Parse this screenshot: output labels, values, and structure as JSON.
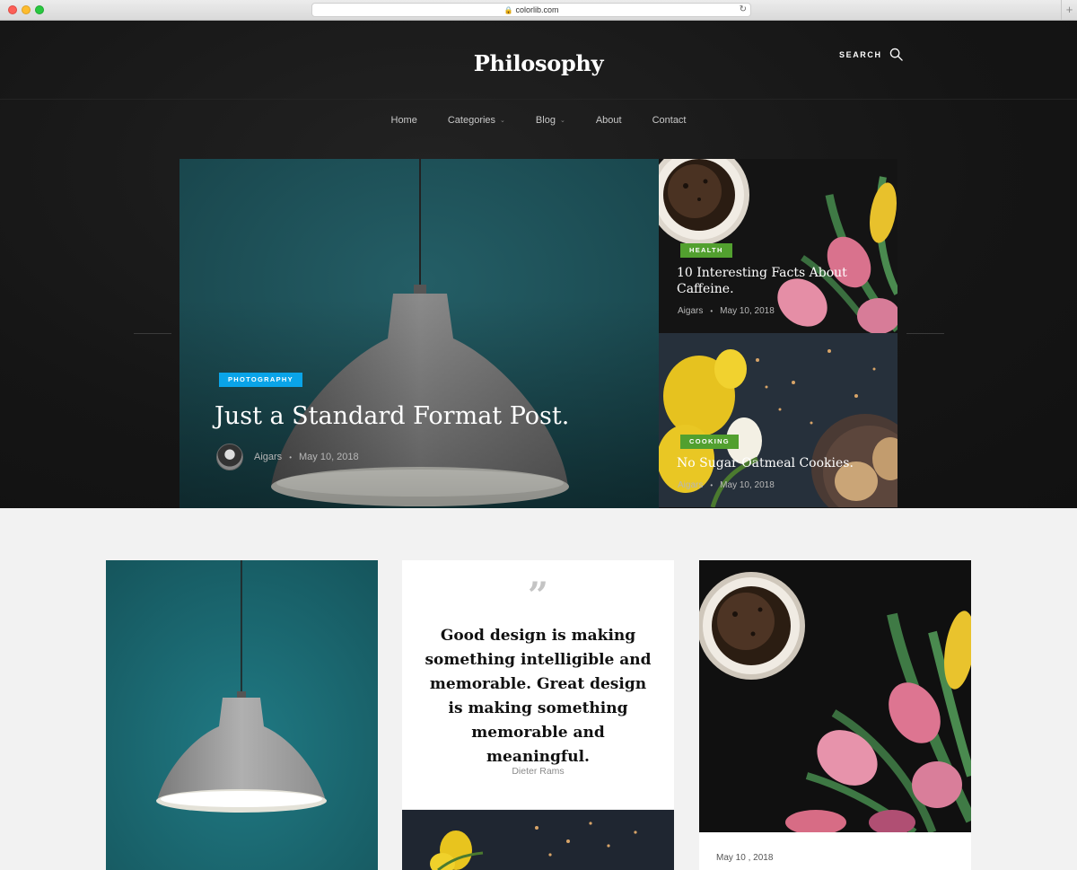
{
  "browser": {
    "url": "colorlib.com"
  },
  "site": {
    "title": "Philosophy",
    "search_label": "SEARCH"
  },
  "nav": [
    {
      "label": "Home"
    },
    {
      "label": "Categories",
      "dropdown": true
    },
    {
      "label": "Blog",
      "dropdown": true
    },
    {
      "label": "About"
    },
    {
      "label": "Contact"
    }
  ],
  "featured": {
    "main": {
      "category": "PHOTOGRAPHY",
      "category_color": "#0aa4e8",
      "title": "Just a Standard Format Post.",
      "author": "Aigars",
      "date": "May 10, 2018"
    },
    "side": [
      {
        "category": "HEALTH",
        "category_color": "#52a02f",
        "title": "10 Interesting Facts About Caffeine.",
        "author": "Aigars",
        "date": "May 10, 2018"
      },
      {
        "category": "COOKING",
        "category_color": "#52a02f",
        "title": "No Sugar Oatmeal Cookies.",
        "author": "Aigars",
        "date": "May 10, 2018"
      }
    ]
  },
  "cards": {
    "quote": {
      "mark": "”",
      "text": "Good design is making something intelligible and memorable. Great design is making something memorable and meaningful.",
      "author": "Dieter Rams"
    },
    "coffee": {
      "date": "May 10 , 2018"
    }
  }
}
